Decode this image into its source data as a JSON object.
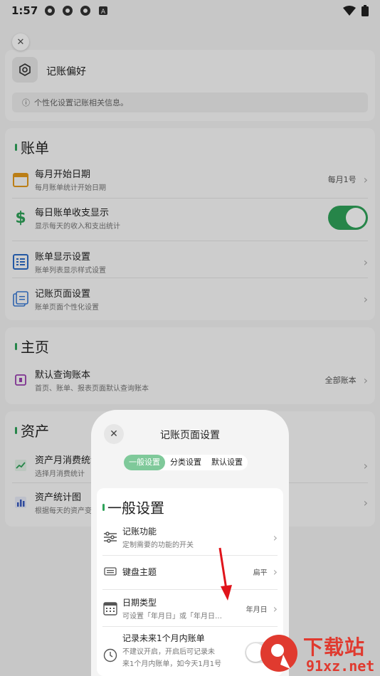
{
  "status_bar": {
    "time": "1:57"
  },
  "preferences": {
    "title": "记账偏好",
    "info": "个性化设置记账相关信息。"
  },
  "bill_section": {
    "title": "账单",
    "items": [
      {
        "title": "每月开始日期",
        "subtitle": "每月账单统计开始日期",
        "value": "每月1号"
      },
      {
        "title": "每日账单收支显示",
        "subtitle": "显示每天的收入和支出统计"
      },
      {
        "title": "账单显示设置",
        "subtitle": "账单列表显示样式设置"
      },
      {
        "title": "记账页面设置",
        "subtitle": "账单页面个性化设置"
      }
    ]
  },
  "home_section": {
    "title": "主页",
    "items": [
      {
        "title": "默认查询账本",
        "subtitle": "首页、账单、报表页面默认查询账本",
        "value": "全部账本"
      }
    ]
  },
  "assets_section": {
    "title": "资产",
    "items": [
      {
        "title": "资产月消费统计",
        "subtitle": "选择月消费统计"
      },
      {
        "title": "资产统计图",
        "subtitle": "根据每天的资产变"
      }
    ]
  },
  "modal": {
    "title": "记账页面设置",
    "tabs": [
      "一般设置",
      "分类设置",
      "默认设置"
    ],
    "section_title": "一般设置",
    "items": [
      {
        "title": "记账功能",
        "subtitle": "定制需要的功能的开关"
      },
      {
        "title": "键盘主题",
        "value": "扁平"
      },
      {
        "title": "日期类型",
        "subtitle": "可设置「年月日」或「年月日…",
        "value": "年月日"
      },
      {
        "title": "记录未来1个月内账单",
        "subtitle": "不建议开启，开启后可记录未",
        "subtitle2": "来1个月内账单，如今天1月1号"
      }
    ]
  },
  "watermark": {
    "brand": "下载站",
    "domain": "91xz.net"
  },
  "colors": {
    "accent": "#2fa35a",
    "tab_active": "#7fc99a",
    "watermark": "#e03a2f"
  }
}
